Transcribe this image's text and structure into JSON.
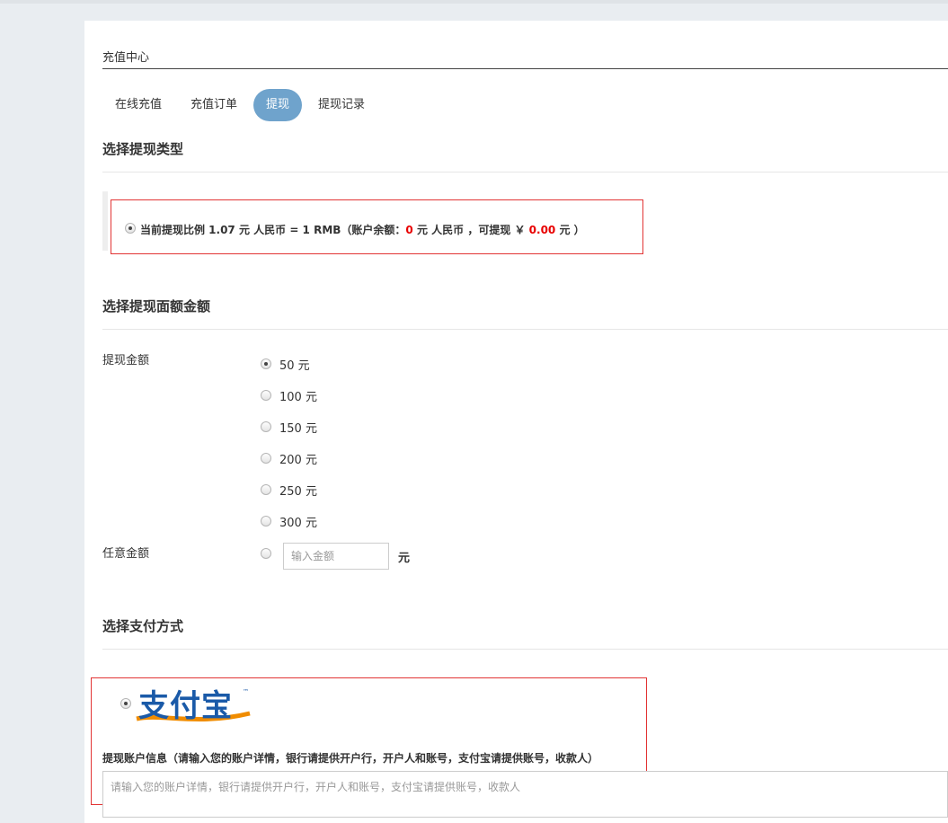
{
  "page": {
    "title": "充值中心"
  },
  "tabs": [
    {
      "label": "在线充值",
      "active": false
    },
    {
      "label": "充值订单",
      "active": false
    },
    {
      "label": "提现",
      "active": true
    },
    {
      "label": "提现记录",
      "active": false
    }
  ],
  "type_section": {
    "title": "选择提现类型",
    "ratio": {
      "prefix": "当前提现比例 1.07 元 人民币 = 1 RMB（账户余额：",
      "balance": "0",
      "middle": " 元 人民币 ，可提现 ￥ ",
      "withdrawable": "0.00",
      "suffix": " 元 ）",
      "selected": true
    }
  },
  "amount_section": {
    "title": "选择提现面额金额",
    "amount_label": "提现金额",
    "options": [
      {
        "label": "50 元",
        "selected": true
      },
      {
        "label": "100 元",
        "selected": false
      },
      {
        "label": "150 元",
        "selected": false
      },
      {
        "label": "200 元",
        "selected": false
      },
      {
        "label": "250 元",
        "selected": false
      },
      {
        "label": "300 元",
        "selected": false
      }
    ],
    "custom_label": "任意金额",
    "custom_placeholder": "输入金额",
    "custom_unit": "元"
  },
  "payment_section": {
    "title": "选择支付方式",
    "method_logo_text": "支付宝",
    "method_selected": true,
    "info_label": "提现账户信息（请输入您的账户详情，银行请提供开户行，开户人和账号，支付宝请提供账号，收款人）",
    "info_placeholder": "请输入您的账户详情，银行请提供开户行，开户人和账号，支付宝请提供账号，收款人"
  },
  "colors": {
    "accent": "#6fa3cc",
    "highlight_red": "#e80000",
    "annotation_red": "#e23434",
    "alipay_blue": "#1a5aa8",
    "alipay_orange": "#f08c00"
  }
}
